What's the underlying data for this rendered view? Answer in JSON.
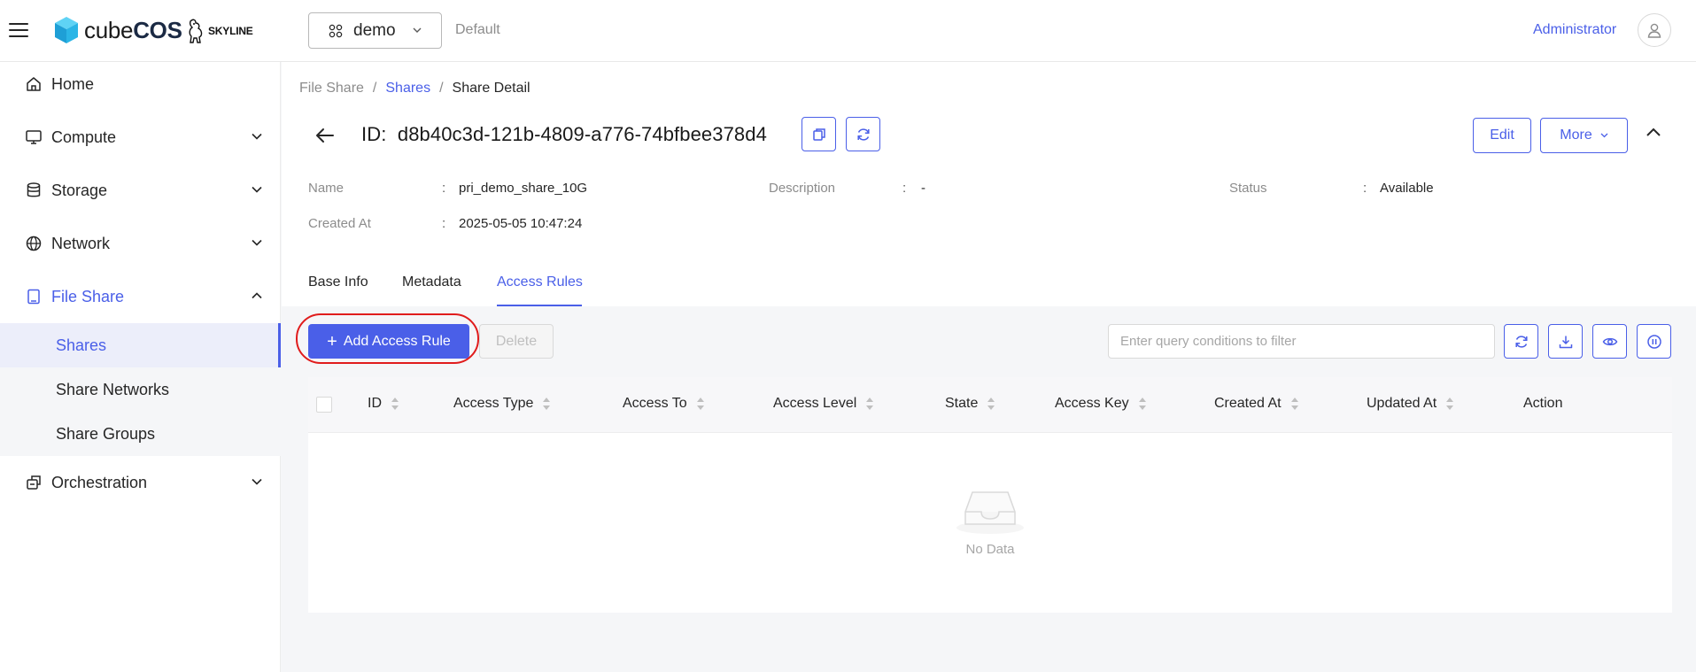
{
  "header": {
    "logo_text_light": "cube",
    "logo_text_bold": "COS",
    "partner_logo_text": "SKYLINE",
    "project": "demo",
    "domain": "Default",
    "user": "Administrator"
  },
  "sidebar": {
    "items": [
      {
        "label": "Home",
        "icon": "home-icon"
      },
      {
        "label": "Compute",
        "icon": "monitor-icon"
      },
      {
        "label": "Storage",
        "icon": "database-icon"
      },
      {
        "label": "Network",
        "icon": "globe-icon"
      },
      {
        "label": "File Share",
        "icon": "file-share-icon"
      },
      {
        "label": "Orchestration",
        "icon": "orchestration-icon"
      }
    ],
    "sub_items": [
      {
        "label": "Shares"
      },
      {
        "label": "Share Networks"
      },
      {
        "label": "Share Groups"
      }
    ]
  },
  "breadcrumb": {
    "root": "File Share",
    "sep": "/",
    "link": "Shares",
    "current": "Share Detail"
  },
  "detail": {
    "id_prefix": "ID:",
    "id_value": "d8b40c3d-121b-4809-a776-74bfbee378d4",
    "edit_label": "Edit",
    "more_label": "More",
    "fields": {
      "name_label": "Name",
      "name_value": "pri_demo_share_10G",
      "description_label": "Description",
      "description_value": "-",
      "status_label": "Status",
      "status_value": "Available",
      "created_label": "Created At",
      "created_value": "2025-05-05 10:47:24",
      "colon": ":"
    }
  },
  "tabs": [
    {
      "label": "Base Info"
    },
    {
      "label": "Metadata"
    },
    {
      "label": "Access Rules",
      "active": true
    }
  ],
  "toolbar": {
    "add_label": "Add Access Rule",
    "add_plus": "+",
    "delete_label": "Delete",
    "filter_placeholder": "Enter query conditions to filter"
  },
  "table": {
    "columns": [
      "ID",
      "Access Type",
      "Access To",
      "Access Level",
      "State",
      "Access Key",
      "Created At",
      "Updated At",
      "Action"
    ],
    "rows": [],
    "empty_text": "No Data"
  },
  "colors": {
    "accent": "#4a5fe8",
    "highlight_ring": "#e01c1c",
    "logo_cube": "#2bb5e6"
  }
}
